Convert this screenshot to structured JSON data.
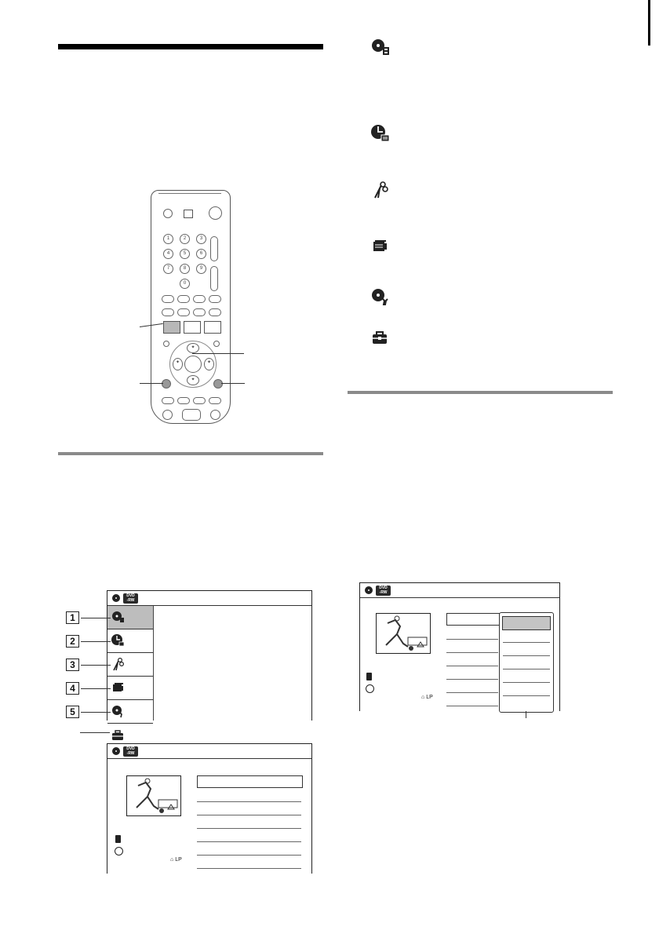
{
  "screens": {
    "top_menu": {
      "badge_top": "DVD",
      "badge_bottom": "-RW",
      "items": [
        {
          "num": "1",
          "icon": "disc-settings-icon"
        },
        {
          "num": "2",
          "icon": "timer-icon"
        },
        {
          "num": "3",
          "icon": "scissors-icon"
        },
        {
          "num": "4",
          "icon": "camera-dub-icon"
        },
        {
          "num": "5",
          "icon": "disc-setup-icon"
        },
        {
          "num": "",
          "icon": "toolbox-icon"
        }
      ]
    },
    "info_screen": {
      "badge_top": "DVD",
      "badge_bottom": "-RW",
      "mode": "LP"
    },
    "dropdown_screen": {
      "badge_top": "DVD",
      "badge_bottom": "-RW",
      "mode": "LP"
    }
  },
  "right_icons": [
    "disc-settings-icon",
    "timer-icon",
    "scissors-icon",
    "camera-dub-icon",
    "disc-setup-icon",
    "toolbox-icon"
  ],
  "remote": {
    "numpad": [
      "1",
      "2",
      "3",
      "4",
      "5",
      "6",
      "7",
      "8",
      "9",
      "0"
    ]
  }
}
